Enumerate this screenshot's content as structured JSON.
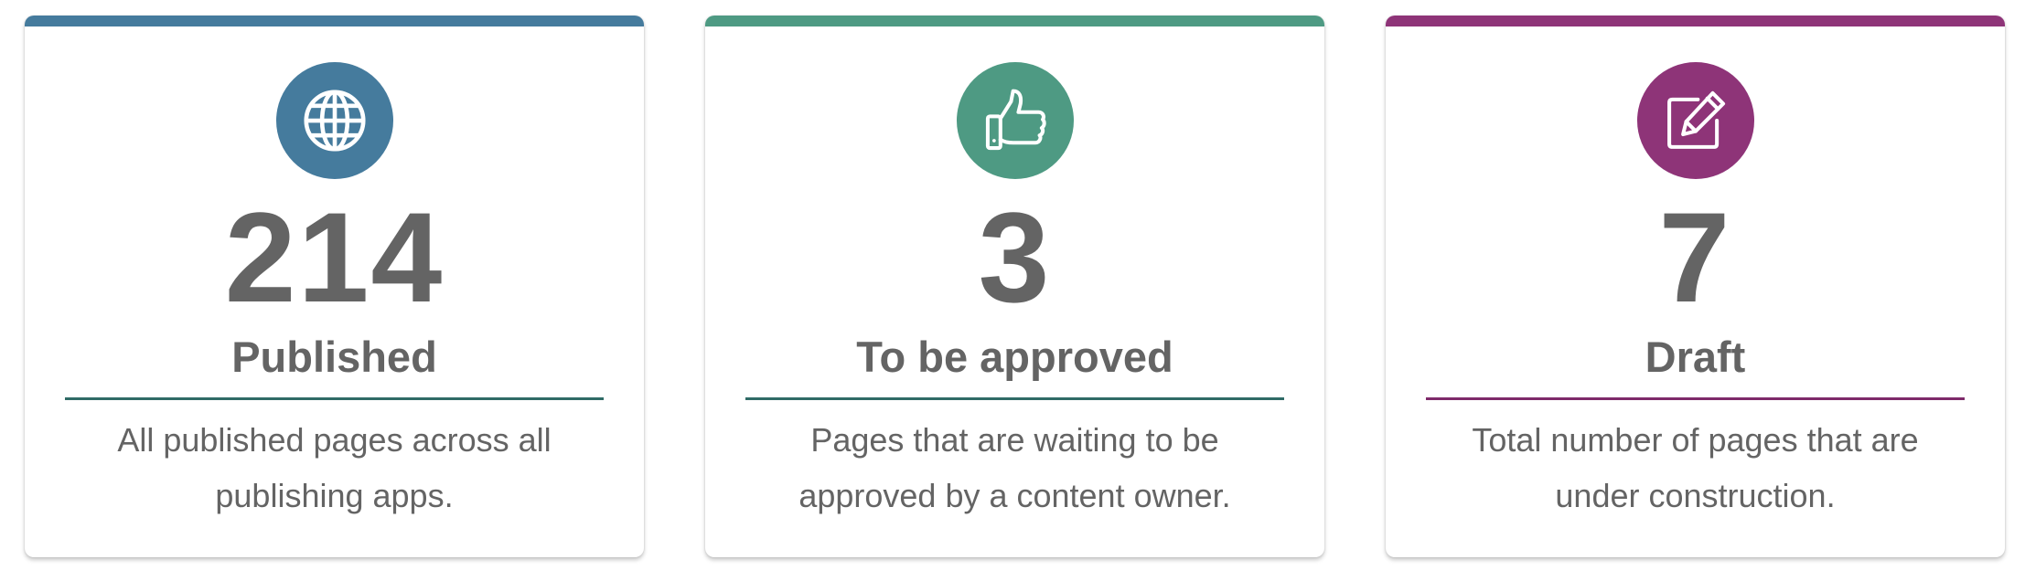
{
  "colors": {
    "published": "#457b9d",
    "approval": "#4e9a83",
    "draft": "#8e3478",
    "divider_published": "#2f6b66",
    "divider_approval": "#2f6b66",
    "divider_draft": "#7e2a6a",
    "text": "#646464"
  },
  "cards": [
    {
      "icon": "globe-icon",
      "count": "214",
      "label": "Published",
      "description": "All published pages across all publishing apps."
    },
    {
      "icon": "thumbs-up-icon",
      "count": "3",
      "label": "To be approved",
      "description": "Pages that are waiting to be approved by a content owner."
    },
    {
      "icon": "edit-icon",
      "count": "7",
      "label": "Draft",
      "description": "Total number of pages that are under construction."
    }
  ]
}
